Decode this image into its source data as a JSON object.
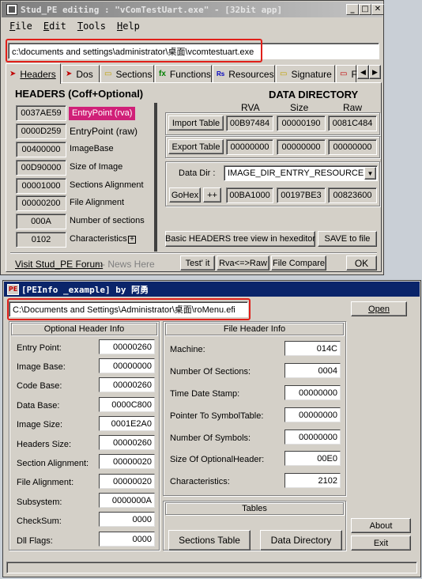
{
  "stud_pe": {
    "title": "Stud_PE editing : \"vComTestUart.exe\" - [32bit app]",
    "menu": [
      "File",
      "Edit",
      "Tools",
      "Help"
    ],
    "path": "c:\\documents and settings\\administrator\\桌面\\vcomtestuart.exe",
    "tabs": [
      {
        "label": "Headers",
        "icon": "headers-icon",
        "icon_color": "#c00000"
      },
      {
        "label": "Dos",
        "icon": "dos-icon",
        "icon_color": "#c00000"
      },
      {
        "label": "Sections",
        "icon": "sections-icon",
        "icon_color": "#c0a000"
      },
      {
        "label": "Functions",
        "icon": "functions-icon",
        "glyph": "fx",
        "icon_color": "#008000"
      },
      {
        "label": "Resources",
        "icon": "resources-icon",
        "glyph": "Rs",
        "icon_color": "#0000c0"
      },
      {
        "label": "Signature",
        "icon": "signature-icon",
        "icon_color": "#c0a000"
      },
      {
        "label": "F",
        "icon": "file-icon",
        "icon_color": "#c00000"
      }
    ],
    "headers_title": "HEADERS (Coff+Optional)",
    "headers": [
      {
        "value": "0037AE59",
        "label": "EntryPoint (rva)",
        "highlight": true
      },
      {
        "value": "0000D259",
        "label": "EntryPoint (raw)"
      },
      {
        "value": "00400000",
        "label": "ImageBase"
      },
      {
        "value": "00D90000",
        "label": "Size of Image"
      },
      {
        "value": "00001000",
        "label": "Sections Alignment"
      },
      {
        "value": "00000200",
        "label": "File Alignment"
      },
      {
        "value": "000A",
        "label": "Number of sections"
      },
      {
        "value": "0102",
        "label": "Characteristics"
      }
    ],
    "characteristics_expand": "+",
    "data_directory": {
      "title": "DATA  DIRECTORY",
      "col_rva": "RVA",
      "col_size": "Size",
      "col_raw": "Raw",
      "import": {
        "label": "Import Table",
        "rva": "00B97484",
        "size": "00000190",
        "raw": "0081C484"
      },
      "export": {
        "label": "Export Table",
        "rva": "00000000",
        "size": "00000000",
        "raw": "00000000"
      },
      "data_dir_label": "Data Dir :",
      "data_dir_selected": "IMAGE_DIR_ENTRY_RESOURCE",
      "gohex": "GoHex",
      "plusplus": "++",
      "rva": "00BA1000",
      "size": "00197BE3",
      "raw": "00823600"
    },
    "basic_headers_btn": "Basic HEADERS tree view in hexeditor",
    "save_btn": "SAVE to file",
    "forum_link": "Visit Stud_PE Forum",
    "news": "<- News Here",
    "test_btn": "Test' it",
    "rva_raw_btn": "Rva<=>Raw",
    "compare_btn": "File Compare",
    "ok_btn": "OK"
  },
  "peinfo": {
    "title": "[PEInfo _example] by 阿勇",
    "icon_text": "PE",
    "path": "C:\\Documents and Settings\\Administrator\\桌面\\roMenu.efi",
    "open_btn": "Open",
    "optional": {
      "title": "Optional Header Info",
      "rows": [
        {
          "label": "Entry Point:",
          "value": "00000260"
        },
        {
          "label": "Image Base:",
          "value": "00000000"
        },
        {
          "label": "Code Base:",
          "value": "00000260"
        },
        {
          "label": "Data Base:",
          "value": "0000C800"
        },
        {
          "label": "Image Size:",
          "value": "0001E2A0"
        },
        {
          "label": "Headers Size:",
          "value": "00000260"
        },
        {
          "label": "Section Alignment:",
          "value": "00000020"
        },
        {
          "label": "File Alignment:",
          "value": "00000020"
        },
        {
          "label": "Subsystem:",
          "value": "0000000A"
        },
        {
          "label": "CheckSum:",
          "value": "0000"
        },
        {
          "label": "Dll Flags:",
          "value": "0000"
        }
      ]
    },
    "file_header": {
      "title": "File Header Info",
      "rows": [
        {
          "label": "Machine:",
          "value": "014C"
        },
        {
          "label": "Number Of Sections:",
          "value": "0004"
        },
        {
          "label": "Time Date Stamp:",
          "value": "00000000"
        },
        {
          "label": "Pointer To SymbolTable:",
          "value": "00000000"
        },
        {
          "label": "Number Of Symbols:",
          "value": "00000000"
        },
        {
          "label": "Size Of OptionalHeader:",
          "value": "00E0"
        },
        {
          "label": "Characteristics:",
          "value": "2102"
        }
      ]
    },
    "tables": {
      "title": "Tables",
      "sections_btn": "Sections Table",
      "data_dir_btn": "Data Directory"
    },
    "about_btn": "About",
    "exit_btn": "Exit"
  },
  "colors": {
    "highlight": "#d02078",
    "annotation_red": "#e0201a",
    "inactive_title": "#8a8a8a",
    "active_title": "#0a246a"
  }
}
